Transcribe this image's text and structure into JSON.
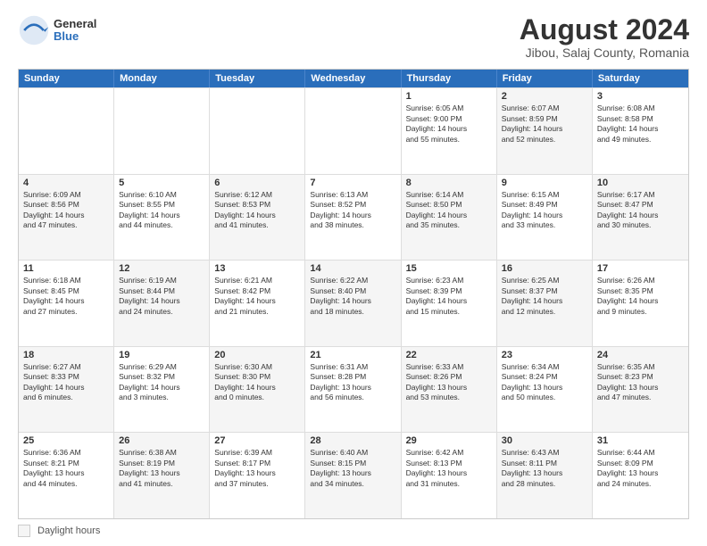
{
  "header": {
    "logo_general": "General",
    "logo_blue": "Blue",
    "main_title": "August 2024",
    "subtitle": "Jibou, Salaj County, Romania"
  },
  "calendar": {
    "days_of_week": [
      "Sunday",
      "Monday",
      "Tuesday",
      "Wednesday",
      "Thursday",
      "Friday",
      "Saturday"
    ],
    "footer_label": "Daylight hours",
    "rows": [
      [
        {
          "day": "",
          "text": "",
          "shaded": false
        },
        {
          "day": "",
          "text": "",
          "shaded": false
        },
        {
          "day": "",
          "text": "",
          "shaded": false
        },
        {
          "day": "",
          "text": "",
          "shaded": false
        },
        {
          "day": "1",
          "text": "Sunrise: 6:05 AM\nSunset: 9:00 PM\nDaylight: 14 hours\nand 55 minutes.",
          "shaded": false
        },
        {
          "day": "2",
          "text": "Sunrise: 6:07 AM\nSunset: 8:59 PM\nDaylight: 14 hours\nand 52 minutes.",
          "shaded": true
        },
        {
          "day": "3",
          "text": "Sunrise: 6:08 AM\nSunset: 8:58 PM\nDaylight: 14 hours\nand 49 minutes.",
          "shaded": false
        }
      ],
      [
        {
          "day": "4",
          "text": "Sunrise: 6:09 AM\nSunset: 8:56 PM\nDaylight: 14 hours\nand 47 minutes.",
          "shaded": true
        },
        {
          "day": "5",
          "text": "Sunrise: 6:10 AM\nSunset: 8:55 PM\nDaylight: 14 hours\nand 44 minutes.",
          "shaded": false
        },
        {
          "day": "6",
          "text": "Sunrise: 6:12 AM\nSunset: 8:53 PM\nDaylight: 14 hours\nand 41 minutes.",
          "shaded": true
        },
        {
          "day": "7",
          "text": "Sunrise: 6:13 AM\nSunset: 8:52 PM\nDaylight: 14 hours\nand 38 minutes.",
          "shaded": false
        },
        {
          "day": "8",
          "text": "Sunrise: 6:14 AM\nSunset: 8:50 PM\nDaylight: 14 hours\nand 35 minutes.",
          "shaded": true
        },
        {
          "day": "9",
          "text": "Sunrise: 6:15 AM\nSunset: 8:49 PM\nDaylight: 14 hours\nand 33 minutes.",
          "shaded": false
        },
        {
          "day": "10",
          "text": "Sunrise: 6:17 AM\nSunset: 8:47 PM\nDaylight: 14 hours\nand 30 minutes.",
          "shaded": true
        }
      ],
      [
        {
          "day": "11",
          "text": "Sunrise: 6:18 AM\nSunset: 8:45 PM\nDaylight: 14 hours\nand 27 minutes.",
          "shaded": false
        },
        {
          "day": "12",
          "text": "Sunrise: 6:19 AM\nSunset: 8:44 PM\nDaylight: 14 hours\nand 24 minutes.",
          "shaded": true
        },
        {
          "day": "13",
          "text": "Sunrise: 6:21 AM\nSunset: 8:42 PM\nDaylight: 14 hours\nand 21 minutes.",
          "shaded": false
        },
        {
          "day": "14",
          "text": "Sunrise: 6:22 AM\nSunset: 8:40 PM\nDaylight: 14 hours\nand 18 minutes.",
          "shaded": true
        },
        {
          "day": "15",
          "text": "Sunrise: 6:23 AM\nSunset: 8:39 PM\nDaylight: 14 hours\nand 15 minutes.",
          "shaded": false
        },
        {
          "day": "16",
          "text": "Sunrise: 6:25 AM\nSunset: 8:37 PM\nDaylight: 14 hours\nand 12 minutes.",
          "shaded": true
        },
        {
          "day": "17",
          "text": "Sunrise: 6:26 AM\nSunset: 8:35 PM\nDaylight: 14 hours\nand 9 minutes.",
          "shaded": false
        }
      ],
      [
        {
          "day": "18",
          "text": "Sunrise: 6:27 AM\nSunset: 8:33 PM\nDaylight: 14 hours\nand 6 minutes.",
          "shaded": true
        },
        {
          "day": "19",
          "text": "Sunrise: 6:29 AM\nSunset: 8:32 PM\nDaylight: 14 hours\nand 3 minutes.",
          "shaded": false
        },
        {
          "day": "20",
          "text": "Sunrise: 6:30 AM\nSunset: 8:30 PM\nDaylight: 14 hours\nand 0 minutes.",
          "shaded": true
        },
        {
          "day": "21",
          "text": "Sunrise: 6:31 AM\nSunset: 8:28 PM\nDaylight: 13 hours\nand 56 minutes.",
          "shaded": false
        },
        {
          "day": "22",
          "text": "Sunrise: 6:33 AM\nSunset: 8:26 PM\nDaylight: 13 hours\nand 53 minutes.",
          "shaded": true
        },
        {
          "day": "23",
          "text": "Sunrise: 6:34 AM\nSunset: 8:24 PM\nDaylight: 13 hours\nand 50 minutes.",
          "shaded": false
        },
        {
          "day": "24",
          "text": "Sunrise: 6:35 AM\nSunset: 8:23 PM\nDaylight: 13 hours\nand 47 minutes.",
          "shaded": true
        }
      ],
      [
        {
          "day": "25",
          "text": "Sunrise: 6:36 AM\nSunset: 8:21 PM\nDaylight: 13 hours\nand 44 minutes.",
          "shaded": false
        },
        {
          "day": "26",
          "text": "Sunrise: 6:38 AM\nSunset: 8:19 PM\nDaylight: 13 hours\nand 41 minutes.",
          "shaded": true
        },
        {
          "day": "27",
          "text": "Sunrise: 6:39 AM\nSunset: 8:17 PM\nDaylight: 13 hours\nand 37 minutes.",
          "shaded": false
        },
        {
          "day": "28",
          "text": "Sunrise: 6:40 AM\nSunset: 8:15 PM\nDaylight: 13 hours\nand 34 minutes.",
          "shaded": true
        },
        {
          "day": "29",
          "text": "Sunrise: 6:42 AM\nSunset: 8:13 PM\nDaylight: 13 hours\nand 31 minutes.",
          "shaded": false
        },
        {
          "day": "30",
          "text": "Sunrise: 6:43 AM\nSunset: 8:11 PM\nDaylight: 13 hours\nand 28 minutes.",
          "shaded": true
        },
        {
          "day": "31",
          "text": "Sunrise: 6:44 AM\nSunset: 8:09 PM\nDaylight: 13 hours\nand 24 minutes.",
          "shaded": false
        }
      ]
    ]
  }
}
